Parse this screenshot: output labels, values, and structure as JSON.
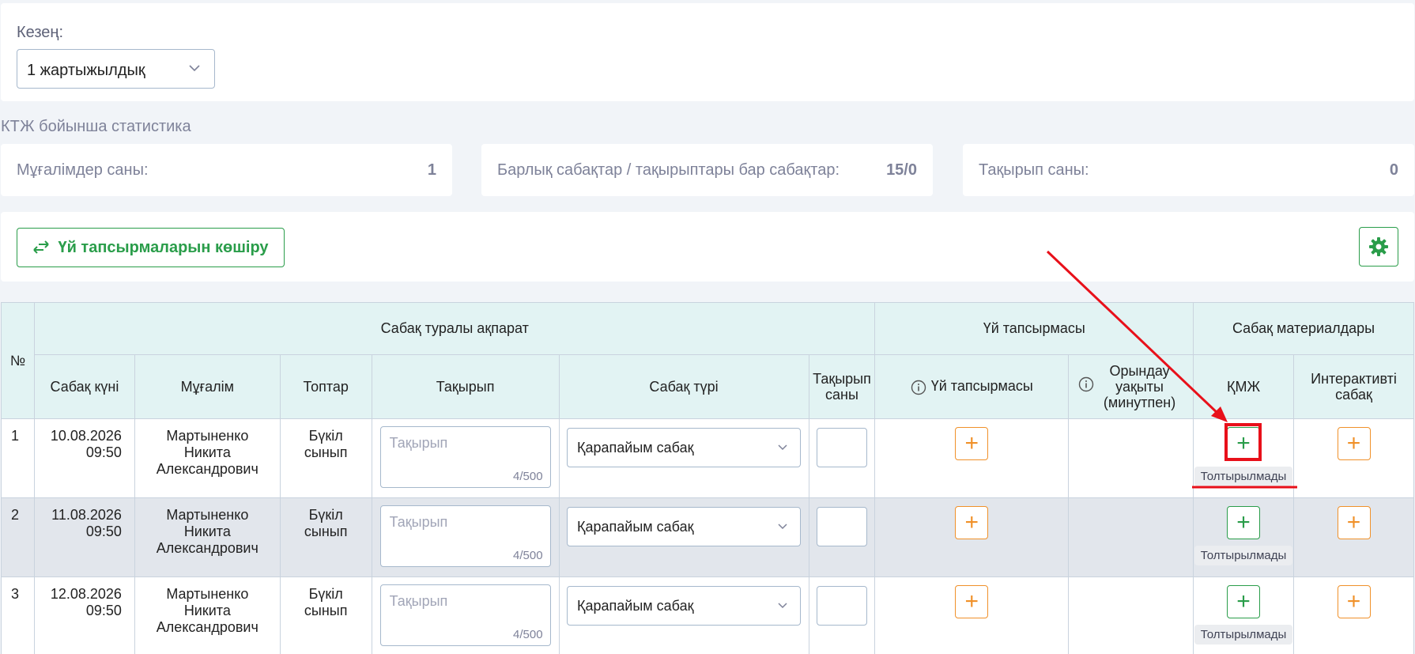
{
  "period": {
    "label": "Кезең:",
    "selected": "1 жартыжылдық"
  },
  "stats": {
    "title": "КТЖ бойынша статистика",
    "cards": [
      {
        "label": "Мұғалімдер саны:",
        "value": "1"
      },
      {
        "label": "Барлық сабақтар / тақырыптары бар сабақтар:",
        "value": "15/0"
      },
      {
        "label": "Тақырып саны:",
        "value": "0"
      }
    ]
  },
  "toolbar": {
    "copy_label": "Үй тапсырмаларын көшіру"
  },
  "table": {
    "group_headers": {
      "num": "№",
      "lesson_info": "Сабақ туралы ақпарат",
      "homework": "Үй тапсырмасы",
      "materials": "Сабақ материалдары"
    },
    "columns": {
      "date": "Сабақ күні",
      "teacher": "Мұғалім",
      "groups": "Топтар",
      "topic": "Тақырып",
      "lesson_type": "Сабақ түрі",
      "topic_count_1": "Тақырып",
      "topic_count_2": "саны",
      "homework": "Үй тапсырмасы",
      "duration_1": "Орындау",
      "duration_2": "уақыты",
      "duration_3": "(минутпен)",
      "kmzh": "ҚМЖ",
      "interactive_1": "Интерактивті",
      "interactive_2": "сабақ"
    },
    "rows": [
      {
        "num": "1",
        "date": "10.08.2026",
        "time": "09:50",
        "teacher_1": "Мартыненко",
        "teacher_2": "Никита",
        "teacher_3": "Александрович",
        "group_1": "Бүкіл",
        "group_2": "сынып",
        "topic_placeholder": "Тақырып",
        "topic_counter": "4/500",
        "lesson_type": "Қарапайым сабақ",
        "status": "Толтырылмады"
      },
      {
        "num": "2",
        "date": "11.08.2026",
        "time": "09:50",
        "teacher_1": "Мартыненко",
        "teacher_2": "Никита",
        "teacher_3": "Александрович",
        "group_1": "Бүкіл",
        "group_2": "сынып",
        "topic_placeholder": "Тақырып",
        "topic_counter": "4/500",
        "lesson_type": "Қарапайым сабақ",
        "status": "Толтырылмады"
      },
      {
        "num": "3",
        "date": "12.08.2026",
        "time": "09:50",
        "teacher_1": "Мартыненко",
        "teacher_2": "Никита",
        "teacher_3": "Александрович",
        "group_1": "Бүкіл",
        "group_2": "сынып",
        "topic_placeholder": "Тақырып",
        "topic_counter": "4/500",
        "lesson_type": "Қарапайым сабақ",
        "status": "Толтырылмады"
      }
    ]
  },
  "colors": {
    "green": "#2a9d4a",
    "orange": "#f0912a",
    "header_bg": "#e2f3f3",
    "annotation": "#e8101a"
  },
  "icons": {
    "select_chevron": "chevron-down-icon",
    "copy": "swap-arrows-icon",
    "settings": "gear-icon",
    "info": "info-circle-icon",
    "add": "plus-icon"
  }
}
